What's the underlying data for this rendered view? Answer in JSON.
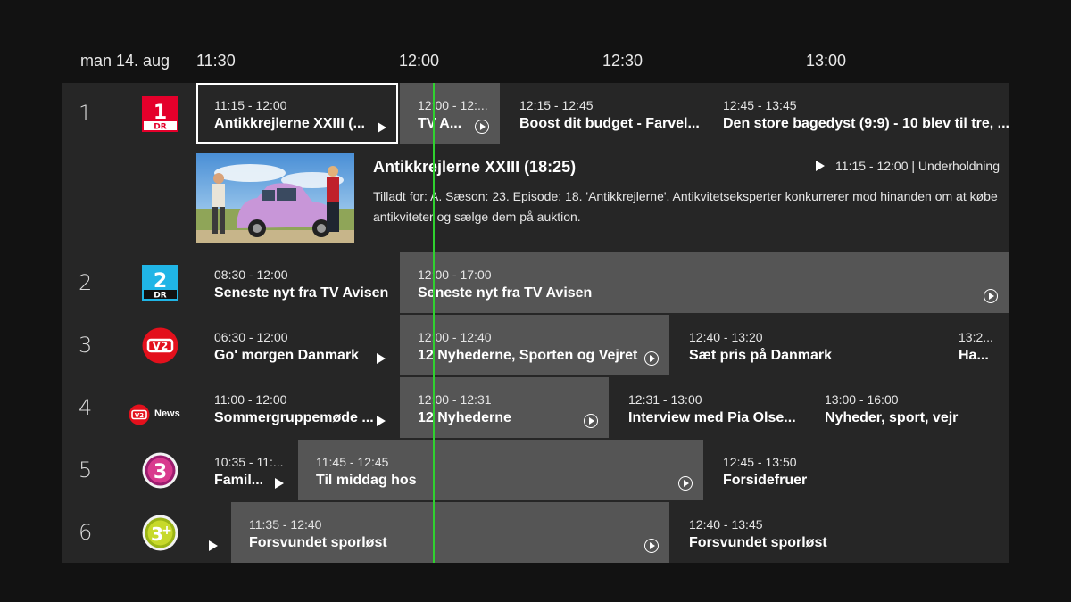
{
  "guide": {
    "date": "man 14. aug",
    "time_ticks": [
      "11:30",
      "12:00",
      "12:30",
      "13:00"
    ]
  },
  "detail": {
    "title": "Antikkrejlerne XXIII (18:25)",
    "meta": "11:15 - 12:00 | Underholdning",
    "description": "Tilladt for: A. Sæson: 23. Episode: 18. 'Antikkrejlerne'. Antikvitetseksperter konkurrerer mod hinanden om at købe antikviteter og sælge dem på auktion."
  },
  "channels": [
    {
      "number": "1",
      "logo": "dr1-logo",
      "programs": [
        {
          "time": "11:15 - 12:00",
          "title": "Antikkrejlerne XXIII (..."
        },
        {
          "time": "12:00 - 12:...",
          "title": "TV A..."
        },
        {
          "time": "12:15 - 12:45",
          "title": "Boost dit budget - Farvel..."
        },
        {
          "time": "12:45 - 13:45",
          "title": "Den store bagedyst (9:9) - 10 blev til tre, ..."
        }
      ]
    },
    {
      "number": "2",
      "logo": "dr2-logo",
      "programs": [
        {
          "time": "08:30 - 12:00",
          "title": "Seneste nyt fra TV Avisen"
        },
        {
          "time": "12:00 - 17:00",
          "title": "Seneste nyt fra TV Avisen"
        }
      ]
    },
    {
      "number": "3",
      "logo": "tv2-logo",
      "programs": [
        {
          "time": "06:30 - 12:00",
          "title": "Go' morgen Danmark"
        },
        {
          "time": "12:00 - 12:40",
          "title": "12 Nyhederne, Sporten og Vejret"
        },
        {
          "time": "12:40 - 13:20",
          "title": "Sæt pris på Danmark"
        },
        {
          "time": "13:2...",
          "title": "Ha..."
        }
      ]
    },
    {
      "number": "4",
      "logo": "tv2-news-logo",
      "logo_text": "News",
      "programs": [
        {
          "time": "11:00 - 12:00",
          "title": "Sommergruppemøde ..."
        },
        {
          "time": "12:00 - 12:31",
          "title": "12 Nyhederne"
        },
        {
          "time": "12:31 - 13:00",
          "title": "Interview med Pia Olse..."
        },
        {
          "time": "13:00 - 16:00",
          "title": "Nyheder, sport, vejr"
        }
      ]
    },
    {
      "number": "5",
      "logo": "tv3-logo",
      "programs": [
        {
          "time": "10:35 - 11:...",
          "title": "Famil..."
        },
        {
          "time": "11:45 - 12:45",
          "title": "Til middag hos"
        },
        {
          "time": "12:45 - 13:50",
          "title": "Forsidefruer"
        }
      ]
    },
    {
      "number": "6",
      "logo": "tv3-plus-logo",
      "programs": [
        {
          "time": "",
          "title": ""
        },
        {
          "time": "11:35 - 12:40",
          "title": "Forsvundet sporløst"
        },
        {
          "time": "12:40 - 13:45",
          "title": "Forsvundet sporløst"
        }
      ]
    }
  ],
  "colors": {
    "background": "#121212",
    "cell": "#262626",
    "current_cell": "#555555",
    "now_line": "#2fd12f",
    "dr1_red": "#e4002b",
    "dr2_cyan": "#20b5e6",
    "tv2_red": "#e3101c"
  }
}
